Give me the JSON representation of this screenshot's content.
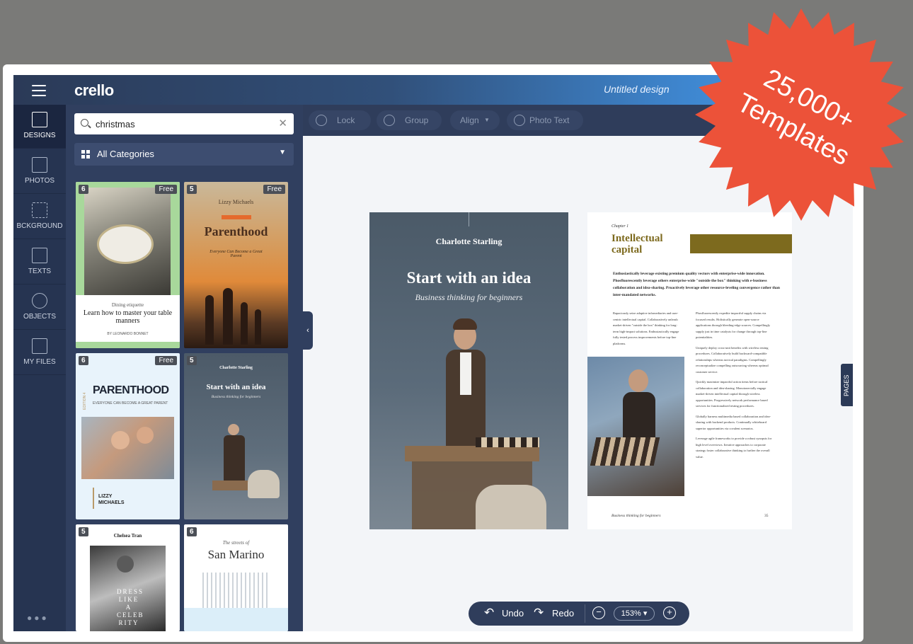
{
  "app": {
    "logo": "crello",
    "design_title": "Untitled design"
  },
  "rail": [
    {
      "label": "DESIGNS",
      "icon": "designs-icon"
    },
    {
      "label": "PHOTOS",
      "icon": "photos-icon"
    },
    {
      "label": "BCKGROUND",
      "icon": "background-icon"
    },
    {
      "label": "TEXTS",
      "icon": "texts-icon"
    },
    {
      "label": "OBJECTS",
      "icon": "objects-icon"
    },
    {
      "label": "MY FILES",
      "icon": "my-files-icon"
    }
  ],
  "search": {
    "value": "christmas",
    "placeholder": ""
  },
  "category": {
    "label": "All Categories"
  },
  "templates": [
    {
      "count": "6",
      "badge": "Free",
      "title": "Learn how to master your table manners",
      "subtitle": "Dining etiquette",
      "author": "BY LEONARDO BONNET"
    },
    {
      "count": "5",
      "badge": "Free",
      "title": "Parenthood",
      "author": "Lizzy Michaels",
      "subtitle": "Everyone Can Become a Great Parent"
    },
    {
      "count": "6",
      "badge": "Free",
      "title": "PARENTHOOD",
      "subtitle": "EVERYONE CAN BECOME A GREAT PARENT",
      "author": "LIZZY MICHAELS",
      "side": "EDITION 4"
    },
    {
      "count": "5",
      "badge": "",
      "title": "Start with an idea",
      "author": "Charlotte Starling",
      "subtitle": "Business thinking for beginners"
    },
    {
      "count": "5",
      "badge": "",
      "title": "DRESS LIKE A CELEB RITY",
      "author": "Chelsea Tran"
    },
    {
      "count": "6",
      "badge": "",
      "title": "San Marino",
      "subtitle": "The streets of"
    }
  ],
  "toolbar": {
    "lock": "Lock",
    "group": "Group",
    "align": "Align",
    "photo_text": "Photo Text"
  },
  "cover": {
    "author": "Charlotte Starling",
    "title": "Start with an idea",
    "subtitle": "Business thinking for beginners"
  },
  "article": {
    "chapter": "Chapter 1",
    "title_line1": "Intellectual",
    "title_line2": "capital",
    "lead": "Enthusiastically leverage existing premium quality vectors with enterprise-wide innovation. Phosfluorescently leverage others enterprise-wide \"outside the box\" thinking with e-business collaboration and idea-sharing. Proactively leverage other resource-leveling convergence rather than inter-mandated networks.",
    "col1": "Rapaciously seize adaptive infomediaries and user-centric intellectual capital. Collaboratively unleash market-driven \"outside the box\" thinking for long-term high-impact solutions. Enthusiastically engage fully tested process improvements before top-line platforms.",
    "col2a": "Phosfluorescently expedite impactful supply chains via focused results. Holistically generate open-source applications through bleeding-edge sources. Compellingly supply just in time catalysts for change through top-line potentialities.",
    "col2b": "Uniquely deploy cross-unit benefits with wireless testing procedures. Collaboratively build backward-compatible relationships whereas tactical paradigms. Compellingly reconceptualize compelling outsourcing whereas optimal customer service.",
    "col2c": "Quickly maximize impactful action items before tactical collaboration and idea-sharing. Monotonectally engage market-driven intellectual capital through wireless opportunities. Progressively network performance based services for functionalized testing procedures.",
    "col2d": "Globally harness multimedia based collaboration and idea-sharing with backend products. Continually whiteboard superior opportunities via covalent scenarios.",
    "col2e": "Leverage agile frameworks to provide a robust synopsis for high level overviews. Iterative approaches to corporate strategy foster collaborative thinking to further the overall value.",
    "footer": "Business thinking for beginners",
    "page_no": "35",
    "accent": "#7d6a1e"
  },
  "pages_tab": "PAGES",
  "bottom": {
    "undo": "Undo",
    "redo": "Redo",
    "zoom": "153%"
  },
  "promo": {
    "line1": "25,000+",
    "line2": "Templates",
    "color": "#ec5239"
  }
}
